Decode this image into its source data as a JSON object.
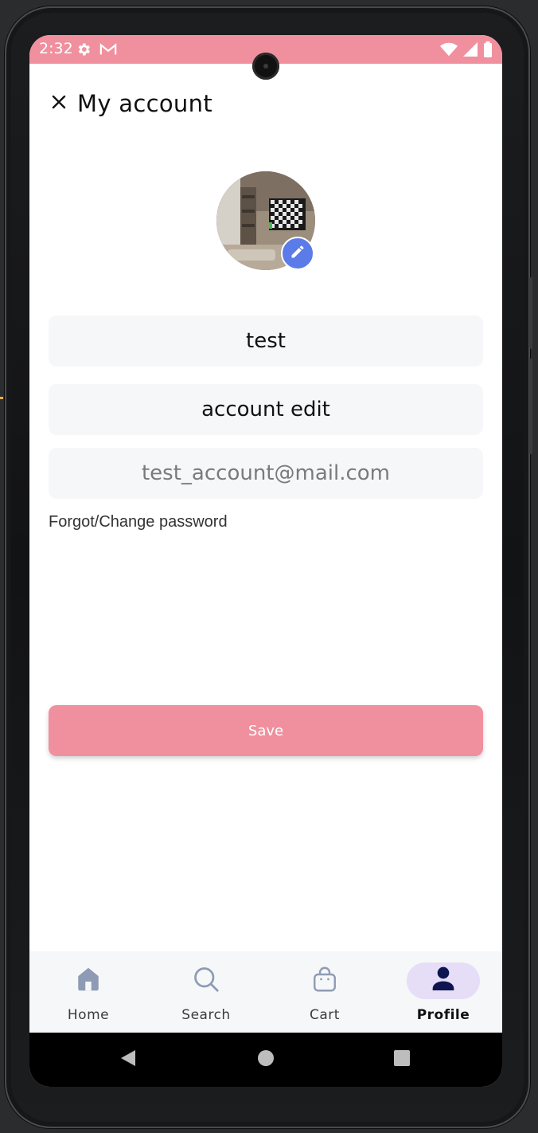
{
  "status_bar": {
    "time": "2:32",
    "icons": [
      "settings-gear-icon",
      "gmail-icon",
      "wifi-icon",
      "signal-icon",
      "battery-icon"
    ],
    "background_color": "#f0909e"
  },
  "header": {
    "close_icon": "close-icon",
    "title": "My account"
  },
  "profile": {
    "avatar": "room-photo-avatar",
    "edit_icon": "pencil-icon",
    "edit_badge_color": "#5b7be8"
  },
  "form": {
    "username_value": "test",
    "display_name_value": "account edit",
    "email_value": "test_account@mail.com",
    "forgot_password_label": "Forgot/Change password",
    "save_label": "Save",
    "save_color": "#f0909e"
  },
  "bottom_nav": {
    "items": [
      {
        "label": "Home",
        "icon": "home-icon",
        "active": false
      },
      {
        "label": "Search",
        "icon": "search-icon",
        "active": false
      },
      {
        "label": "Cart",
        "icon": "shopping-bag-icon",
        "active": false
      },
      {
        "label": "Profile",
        "icon": "person-icon",
        "active": true
      }
    ],
    "active_pill_color": "#e6ddf7"
  },
  "system_nav": {
    "icons": [
      "back-icon",
      "home-circle-icon",
      "recents-icon"
    ]
  }
}
